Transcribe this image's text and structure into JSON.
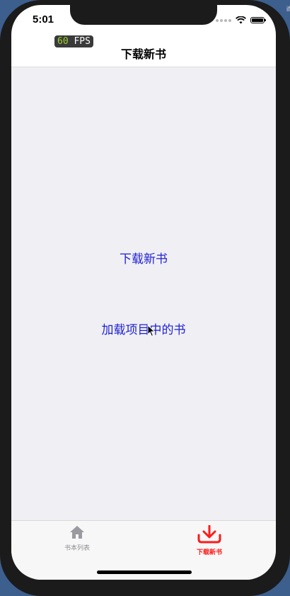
{
  "status_bar": {
    "time": "5:01"
  },
  "fps_badge": {
    "value": "60",
    "unit": "FPS"
  },
  "nav": {
    "title": "下载新书"
  },
  "content": {
    "download_new_books_label": "下载新书",
    "load_project_books_label": "加载项目中的书"
  },
  "tabbar": {
    "items": [
      {
        "label": "书本列表",
        "icon": "home-icon",
        "selected": false,
        "color": "#8e8e93"
      },
      {
        "label": "下载新书",
        "icon": "download-icon",
        "selected": true,
        "color": "#ff1a1a"
      }
    ]
  },
  "colors": {
    "link": "#1f1fd6",
    "content_background": "#efeff4",
    "accent": "#ff1a1a"
  }
}
